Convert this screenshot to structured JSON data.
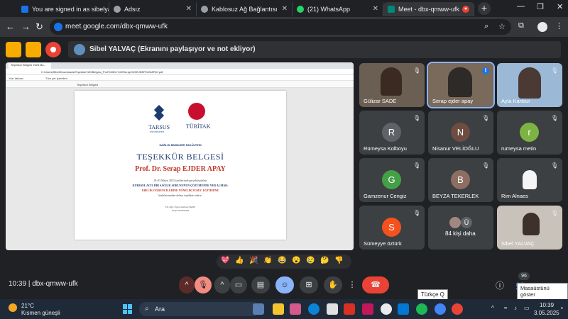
{
  "browser": {
    "tabs": [
      {
        "title": "You are signed in as sibelyal",
        "favicon_color": "#1a73e8"
      },
      {
        "title": "Adsız",
        "favicon_color": "#9aa0a6"
      },
      {
        "title": "Kablosuz Ağ Bağlantısı",
        "favicon_color": "#9aa0a6"
      },
      {
        "title": "(21) WhatsApp",
        "favicon_color": "#25d366"
      },
      {
        "title": "Meet - dbx-qmww-ufk",
        "favicon_color": "#00897b"
      }
    ],
    "new_tab_label": "+",
    "url": "meet.google.com/dbx-qmww-ufk"
  },
  "share_banner": {
    "presenter_text": "Sibel YALVAÇ (Ekranını paylaşıyor ve not ekliyor)"
  },
  "presentation": {
    "inner_tab": "Teşekkür Belgesi 2025-Ba...",
    "inner_url": "C:/Users/Sibel/Downloads/Teşekkür%20Belgesi_Prof%20Dr.%20Serap%20EJDER%20APAY.pdf",
    "bookmark_1": "Yazı tahtası",
    "bookmark_2": "Tüm yer işaretleri",
    "pdf_title": "Teşekkür Belgesi",
    "certificate": {
      "university": "TARSUS",
      "university_sub": "ÜNİVERSİTESİ",
      "tubitak": "TÜBİTAK",
      "faculty": "SAĞLIK BİLİMLERİ FAKÜLTESİ",
      "heading": "TEŞEKKÜR BELGESİ",
      "recipient": "Prof. Dr. Serap EJDER APAY",
      "line1": "01-03 Mayıs 2025 tarihlerinde gerçekleştirilen",
      "line2": "KÜRESEL ACİL BİR SAĞLIK SORUNUNUN ÇÖZÜMÜNDE YER ALMAK:",
      "line3": "EBELİK ÖĞRENCİLERİNE YÖNELİK FGM/C EĞİTİMİNE",
      "line4": "katkılarınızdan dolayı teşekkür ederiz.",
      "sign_name": "Dr. Öğr. Üyesi Gülcan SADE",
      "sign_role": "Proje Yürütücüsü"
    }
  },
  "participants": [
    {
      "name": "Gülizar SADE",
      "initial": "",
      "type": "video",
      "muted": true
    },
    {
      "name": "Serap ejder apay",
      "initial": "",
      "type": "video",
      "muted": false,
      "speaking": true
    },
    {
      "name": "Ayla Kanbur",
      "initial": "",
      "type": "video",
      "muted": true
    },
    {
      "name": "Rümeysa Kolboyu",
      "initial": "R",
      "color": "#5f6368",
      "muted": true
    },
    {
      "name": "Nisanur VELİOĞLU",
      "initial": "N",
      "color": "#6d4c41",
      "muted": true
    },
    {
      "name": "rumeysa metin",
      "initial": "r",
      "color": "#7cb342",
      "muted": true
    },
    {
      "name": "Gamzenur Cengiz",
      "initial": "G",
      "color": "#43a047",
      "muted": true
    },
    {
      "name": "BEYZA TEKERLEK",
      "initial": "B",
      "color": "#8d6e63",
      "muted": true
    },
    {
      "name": "Rim Alnaes",
      "initial": "",
      "type": "photo",
      "muted": true
    },
    {
      "name": "Sümeyye öztürk",
      "initial": "S",
      "color": "#f4511e",
      "muted": true
    },
    {
      "name": "84 kişi daha",
      "initial": "Ü",
      "type": "more",
      "muted": false
    },
    {
      "name": "Sibel YALVAÇ",
      "initial": "",
      "type": "video",
      "muted": true
    }
  ],
  "reactions": [
    "💖",
    "👍",
    "🎉",
    "👏",
    "😂",
    "😮",
    "😢",
    "🤔",
    "👎"
  ],
  "meet_bar": {
    "time": "10:39",
    "separator": "|",
    "code": "dbx-qmww-ufk",
    "people_count": "96"
  },
  "tooltips": {
    "keyboard": "Türkçe Q",
    "desktop": "Masaüstünü göster"
  },
  "taskbar": {
    "weather_temp": "21°C",
    "weather_desc": "Kısmen güneşli",
    "search_placeholder": "Ara",
    "clock_time": "10:39",
    "clock_date": "3.05.2025"
  }
}
